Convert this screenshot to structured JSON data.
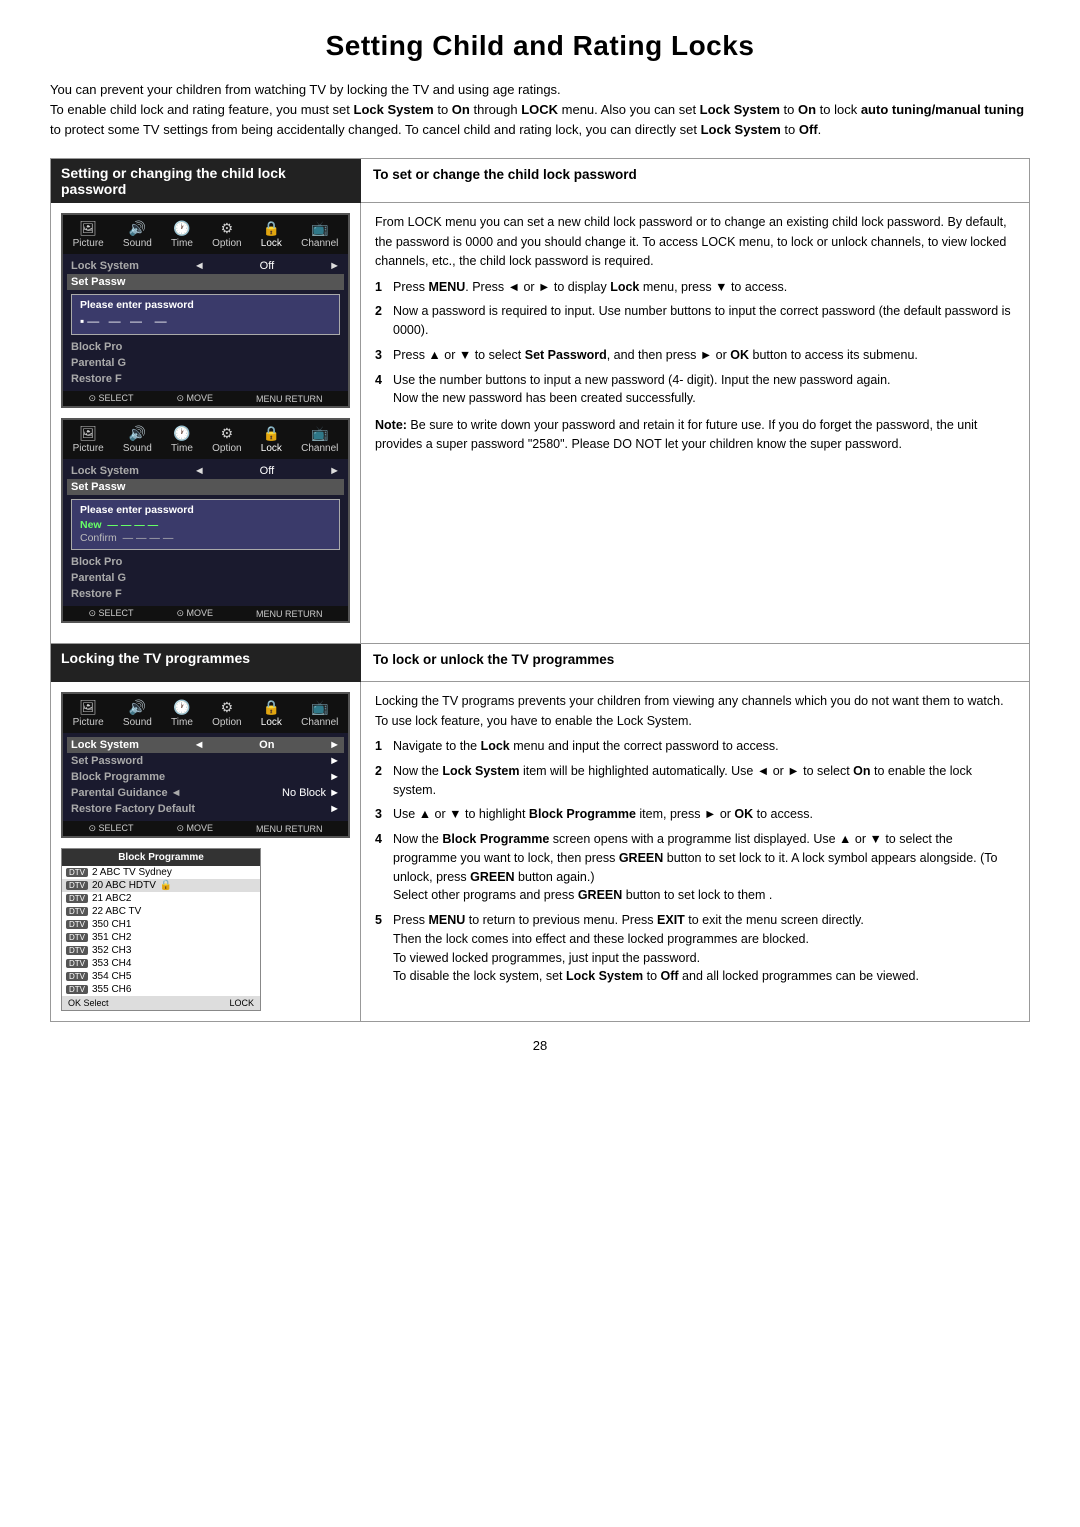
{
  "title": "Setting Child and Rating Locks",
  "intro": {
    "line1": "You can prevent your children from watching TV by locking the TV and using age ratings.",
    "line2": "To enable child lock and rating feature, you must set Lock System to On through LOCK menu. Also you can set Lock System to On to lock auto tuning/manual tuning to protect some TV settings from being accidentally changed.  To cancel child  and rating lock, you can directly set Lock System to Off."
  },
  "section1": {
    "header": "Setting or changing the child lock password",
    "right_header": "To set or change the child lock password",
    "right_text": "From LOCK menu you can set a new child lock password or to change an existing child lock password. By default, the password is 0000 and you should change it. To access LOCK menu, to lock or unlock channels, to view locked channels, etc., the child lock password is required.",
    "steps": [
      {
        "num": "1",
        "text": "Press MENU. Press ◄ or ► to display Lock menu, press ▼ to access."
      },
      {
        "num": "2",
        "text": "Now a password is required to input. Use number buttons to input the correct password (the default password is 0000)."
      },
      {
        "num": "3",
        "text": "Press ▲ or ▼ to select Set Password, and then press ► or OK button to access its submenu."
      },
      {
        "num": "4",
        "text": "Use  the number buttons to input a  new password (4- digit). Input the new password again. Now the new password has been created successfully."
      }
    ],
    "note": "Note:  Be sure to write down your password and retain it for future use. If you do forget the password, the unit provides a  super password \"2580\". Please DO NOT let your children know the super password."
  },
  "menu1": {
    "tabs": [
      "Picture",
      "Sound",
      "Time",
      "Option",
      "Lock",
      "Channel"
    ],
    "tab_icons": [
      "🖼",
      "🔊",
      "🕐",
      "⚙",
      "🔒",
      "📺"
    ],
    "active_tab": "Lock",
    "rows": [
      {
        "label": "Lock System",
        "value": "Off"
      },
      {
        "label": "Set Passw",
        "value": ""
      },
      {
        "label": "Block Pro",
        "value": ""
      },
      {
        "label": "Parental G",
        "value": ""
      },
      {
        "label": "Restore F",
        "value": ""
      }
    ],
    "overlay": {
      "title": "Please enter password",
      "dots": "— — —  —"
    }
  },
  "menu2": {
    "tabs": [
      "Picture",
      "Sound",
      "Time",
      "Option",
      "Lock",
      "Channel"
    ],
    "tab_icons": [
      "🖼",
      "🔊",
      "🕐",
      "⚙",
      "🔒",
      "📺"
    ],
    "active_tab": "Lock",
    "rows": [
      {
        "label": "Lock System",
        "value": "Off"
      },
      {
        "label": "Set Passw",
        "value": ""
      },
      {
        "label": "Block Pro",
        "value": ""
      },
      {
        "label": "Parental G",
        "value": ""
      },
      {
        "label": "Restore F",
        "value": ""
      }
    ],
    "overlay": {
      "title": "Please enter password",
      "new_label": "New",
      "new_dots": "— — —  —",
      "confirm_label": "Confirm",
      "confirm_dots": "— — —  —"
    }
  },
  "section2": {
    "header": "Locking the TV programmes",
    "right_header": "To lock or unlock the TV programmes",
    "right_text": "Locking the TV programs prevents your children from viewing any channels which you do not want them to watch. To use lock feature, you have to enable the Lock System.",
    "steps": [
      {
        "num": "1",
        "text": "Navigate to the Lock menu and input the correct password to access."
      },
      {
        "num": "2",
        "text": "Now the Lock System item will be highlighted automatically. Use ◄ or ► to select On to enable the lock system."
      },
      {
        "num": "3",
        "text": "Use ▲ or ▼ to highlight Block Programme item, press ► or OK to access."
      },
      {
        "num": "4",
        "text": "Now the Block Programme screen opens with a programme list displayed.  Use ▲ or ▼ to select the programme you want to lock, then press GREEN button to set lock to it. A lock symbol appears alongside.  (To unlock, press GREEN button again.) Select other programs and press GREEN button to set lock to them . "
      },
      {
        "num": "5",
        "text": "Press MENU to return to previous menu. Press EXIT to exit the menu screen directly. Then the lock comes into effect and these locked programmes are blocked. To viewed locked programmes, just input the password. To disable the lock system, set Lock System to Off and all locked programmes can be viewed."
      }
    ]
  },
  "menu3": {
    "tabs": [
      "Picture",
      "Sound",
      "Time",
      "Option",
      "Lock",
      "Channel"
    ],
    "tab_icons": [
      "🖼",
      "🔊",
      "🕐",
      "⚙",
      "🔒",
      "📺"
    ],
    "active_tab": "Lock",
    "rows": [
      {
        "label": "Lock System",
        "left_arrow": "◄",
        "value": "On",
        "right_arrow": "►"
      },
      {
        "label": "Set Password",
        "right_arrow": "►"
      },
      {
        "label": "Block Programme",
        "right_arrow": "►"
      },
      {
        "label": "Parental Guidance",
        "left_arrow": "◄",
        "value": "No Block",
        "right_arrow": "►"
      },
      {
        "label": "Restore Factory Default",
        "right_arrow": "►"
      }
    ]
  },
  "block_programme": {
    "header": "Block Programme",
    "channels": [
      {
        "badge": "DTV",
        "name": "2 ABC TV Sydney",
        "locked": false,
        "selected": false
      },
      {
        "badge": "DTV",
        "name": "20 ABC HDTV",
        "locked": true,
        "selected": true
      },
      {
        "badge": "DTV",
        "name": "21 ABC2",
        "locked": false,
        "selected": false
      },
      {
        "badge": "DTV",
        "name": "22 ABC TV",
        "locked": false,
        "selected": false
      },
      {
        "badge": "DTV",
        "name": "350 CH1",
        "locked": false,
        "selected": false
      },
      {
        "badge": "DTV",
        "name": "351 CH2",
        "locked": false,
        "selected": false
      },
      {
        "badge": "DTV",
        "name": "352 CH3",
        "locked": false,
        "selected": false
      },
      {
        "badge": "DTV",
        "name": "353 CH4",
        "locked": false,
        "selected": false
      },
      {
        "badge": "DTV",
        "name": "354 CH5",
        "locked": false,
        "selected": false
      },
      {
        "badge": "DTV",
        "name": "355 CH6",
        "locked": false,
        "selected": false
      }
    ],
    "footer_select": "OK  Select",
    "footer_lock": "LOCK"
  },
  "page_number": "28"
}
